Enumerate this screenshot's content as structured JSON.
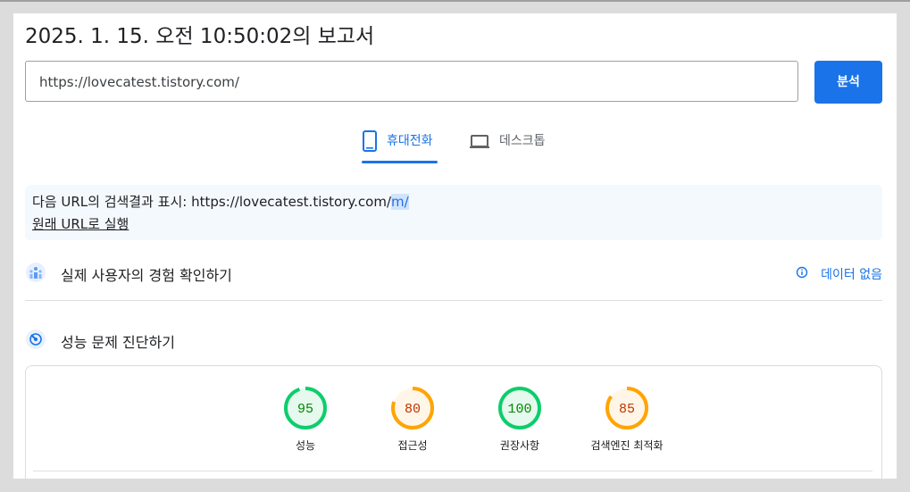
{
  "report": {
    "title": "2025. 1. 15. 오전 10:50:02의 보고서"
  },
  "url_input": {
    "value": "https://lovecatest.tistory.com/"
  },
  "analyze_button": {
    "label": "분석"
  },
  "tabs": [
    {
      "label": "휴대전화",
      "icon": "mobile-phone-icon",
      "active": true
    },
    {
      "label": "데스크톱",
      "icon": "laptop-icon",
      "active": false
    }
  ],
  "notice": {
    "prefix": "다음 URL의 검색결과 표시: https://lovecatest.tistory.com/",
    "highlight": "m/",
    "link": "원래 URL로 실행"
  },
  "crux": {
    "title": "실제 사용자의 경험 확인하기",
    "no_data": "데이터 없음"
  },
  "diagnostics": {
    "title": "성능 문제 진단하기"
  },
  "scores": [
    {
      "value": "95",
      "label": "성능",
      "status": "pass"
    },
    {
      "value": "80",
      "label": "접근성",
      "status": "average"
    },
    {
      "value": "100",
      "label": "권장사항",
      "status": "pass"
    },
    {
      "value": "85",
      "label": "검색엔진 최적화",
      "status": "average"
    }
  ],
  "colors": {
    "accent": "#1a73e8",
    "pass": "#0cce6b",
    "pass_text": "#008800",
    "pass_bg": "#e6f9ee",
    "average": "#ffa400",
    "average_text": "#c33300",
    "average_bg": "#fff6e8"
  }
}
